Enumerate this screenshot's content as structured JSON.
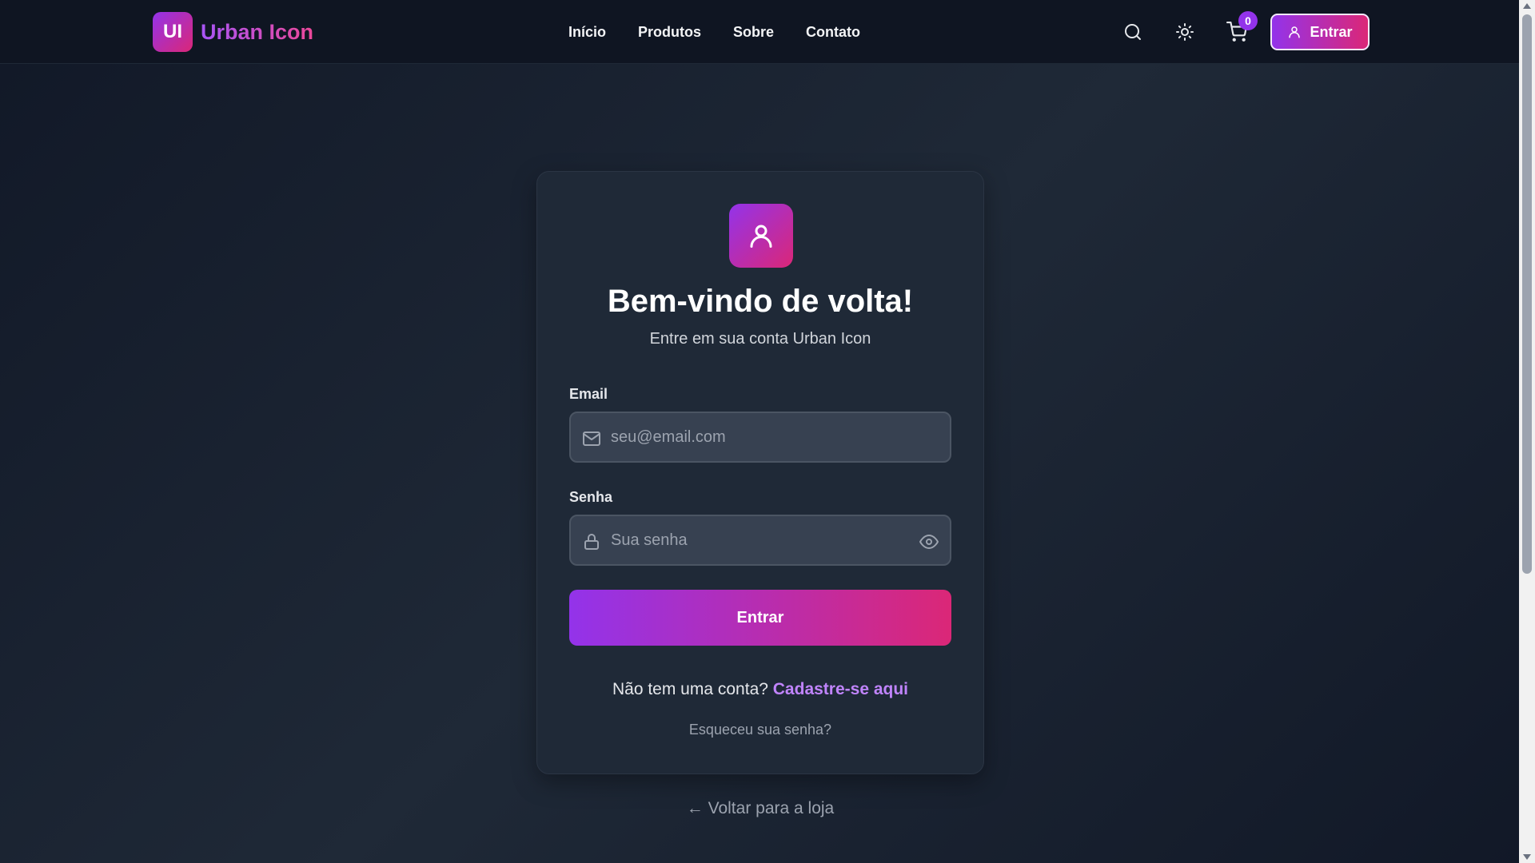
{
  "header": {
    "logo_badge": "UI",
    "logo_text": "Urban Icon",
    "nav": [
      "Início",
      "Produtos",
      "Sobre",
      "Contato"
    ],
    "cart_count": "0",
    "login_label": "Entrar",
    "icons": [
      "search-icon",
      "sun-icon",
      "cart-icon",
      "user-icon"
    ]
  },
  "login": {
    "title": "Bem-vindo de volta!",
    "subtitle": "Entre em sua conta Urban Icon",
    "email_label": "Email",
    "email_placeholder": "seu@email.com",
    "email_value": "",
    "password_label": "Senha",
    "password_placeholder": "Sua senha",
    "password_value": "",
    "submit_label": "Entrar",
    "no_account_text": "Não tem uma conta?",
    "signup_link": "Cadastre-se aqui",
    "forgot_link": "Esqueceu sua senha?",
    "back_link": "← Voltar para a loja"
  },
  "colors": {
    "accent_start": "#9333ea",
    "accent_end": "#db2777",
    "background": "#111827",
    "card": "#1f2937",
    "link": "#c084fc"
  }
}
